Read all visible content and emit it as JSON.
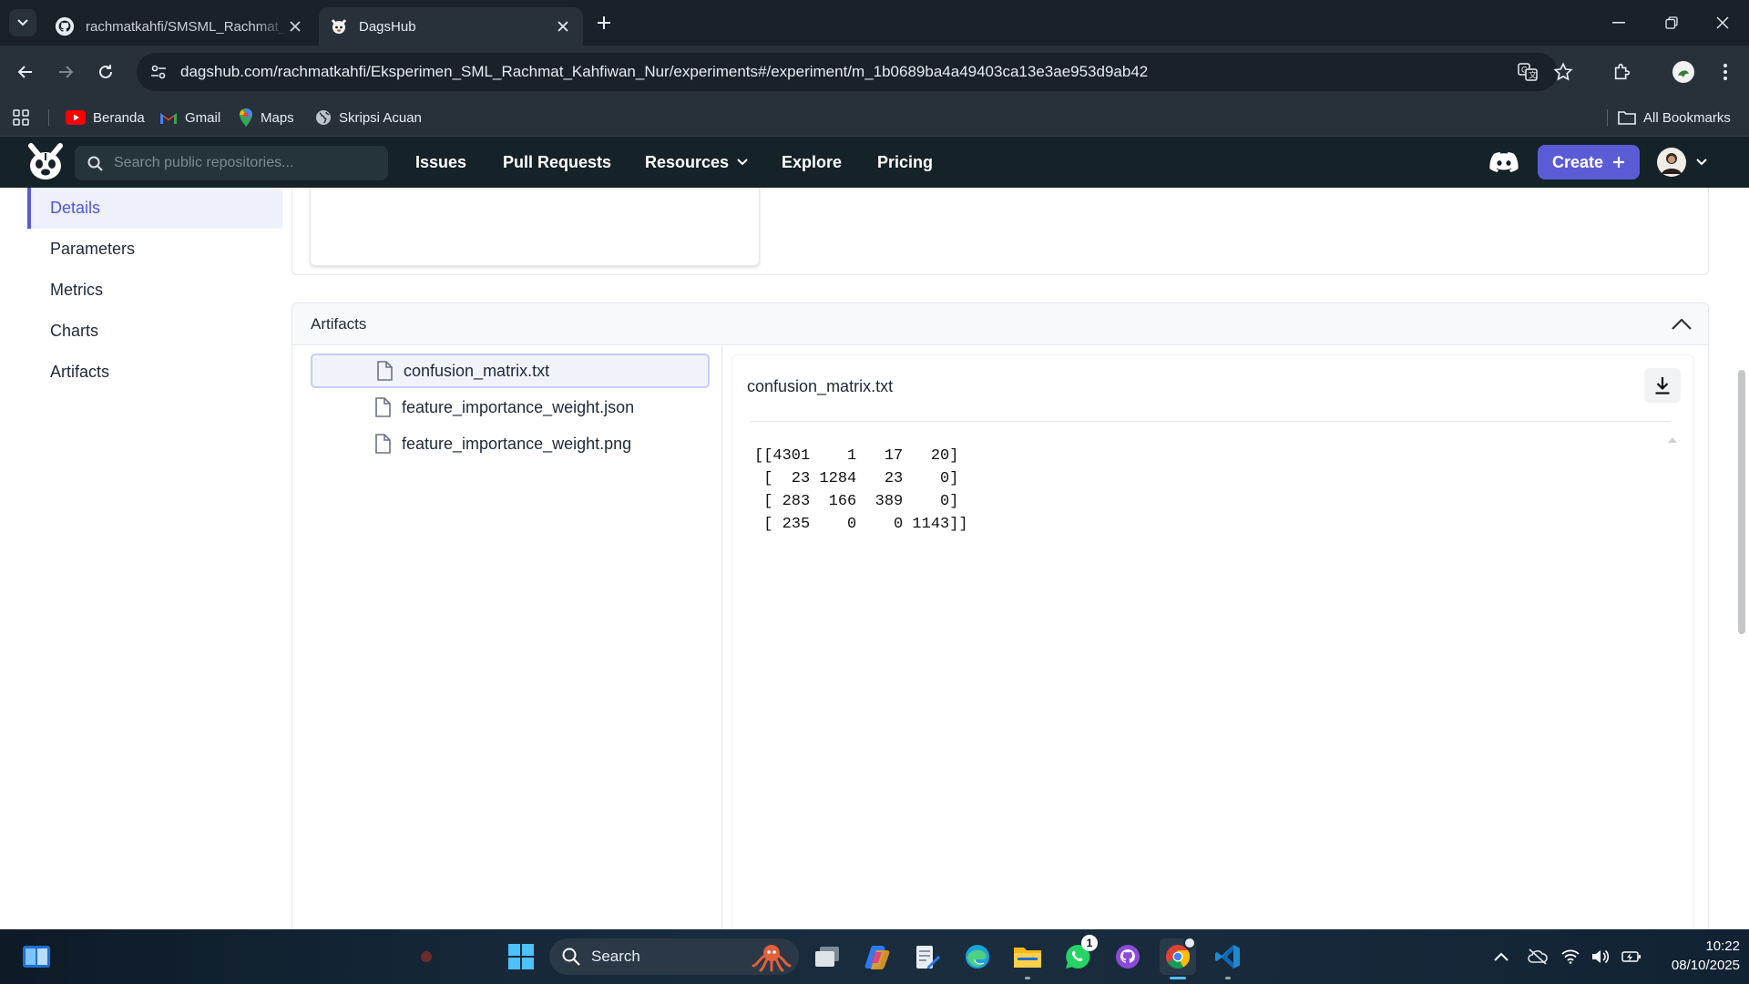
{
  "browser": {
    "tabs": [
      {
        "title": "rachmatkahfi/SMSML_Rachmat_Kahfiwan_Nur",
        "icon": "github-icon",
        "active": false
      },
      {
        "title": "DagsHub",
        "icon": "dagshub-icon",
        "active": true
      }
    ],
    "url": "dagshub.com/rachmatkahfi/Eksperimen_SML_Rachmat_Kahfiwan_Nur/experiments#/experiment/m_1b0689ba4a49403ca13e3ae953d9ab42",
    "bookmarks": [
      {
        "label": "Beranda",
        "icon": "youtube-icon"
      },
      {
        "label": "Gmail",
        "icon": "gmail-icon"
      },
      {
        "label": "Maps",
        "icon": "maps-icon"
      },
      {
        "label": "Skripsi Acuan",
        "icon": "globe-icon"
      }
    ],
    "all_bookmarks": "All Bookmarks"
  },
  "site": {
    "search_placeholder": "Search public repositories...",
    "nav": [
      "Issues",
      "Pull Requests",
      "Resources",
      "Explore",
      "Pricing"
    ],
    "create_label": "Create"
  },
  "sidebar": {
    "items": [
      "Details",
      "Parameters",
      "Metrics",
      "Charts",
      "Artifacts"
    ],
    "active_index": 0
  },
  "artifacts": {
    "header": "Artifacts",
    "files": [
      "confusion_matrix.txt",
      "feature_importance_weight.json",
      "feature_importance_weight.png"
    ],
    "selected_index": 0,
    "preview_title": "confusion_matrix.txt",
    "preview_content": "[[4301    1   17   20]\n [  23 1284   23    0]\n [ 283  166  389    0]\n [ 235    0    0 1143]]"
  },
  "taskbar": {
    "search_label": "Search",
    "whatsapp_badge": "1",
    "time": "10:22",
    "date": "08/10/2025"
  },
  "colors": {
    "accent": "#5b5bd6",
    "site_nav_bg": "#152228",
    "browser_bg": "#28303a"
  }
}
